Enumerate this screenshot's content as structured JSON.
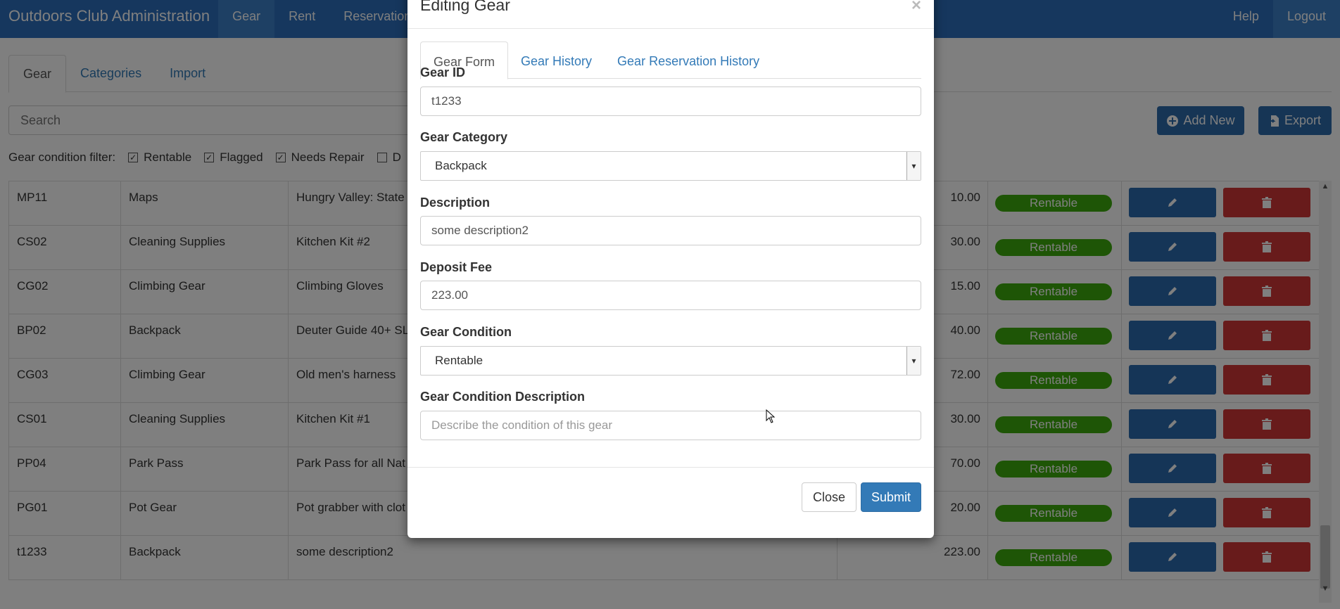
{
  "navbar": {
    "brand": "Outdoors Club Administration",
    "items": [
      {
        "label": "Gear"
      },
      {
        "label": "Rent"
      },
      {
        "label": "Reservations"
      }
    ],
    "right": [
      {
        "label": "Help"
      },
      {
        "label": "Logout"
      }
    ]
  },
  "subtabs": [
    {
      "label": "Gear"
    },
    {
      "label": "Categories"
    },
    {
      "label": "Import"
    }
  ],
  "toolbar": {
    "search_placeholder": "Search",
    "add_new_label": "Add New",
    "export_label": "Export"
  },
  "filter": {
    "label": "Gear condition filter:",
    "options": [
      {
        "label": "Rentable",
        "checked": true
      },
      {
        "label": "Flagged",
        "checked": true
      },
      {
        "label": "Needs Repair",
        "checked": true
      },
      {
        "label": "D",
        "checked": false
      }
    ]
  },
  "table": {
    "rows": [
      {
        "id": "MP11",
        "category": "Maps",
        "description": "Hungry Valley: State",
        "fee": "10.00",
        "condition": "Rentable"
      },
      {
        "id": "CS02",
        "category": "Cleaning Supplies",
        "description": "Kitchen Kit #2",
        "fee": "30.00",
        "condition": "Rentable"
      },
      {
        "id": "CG02",
        "category": "Climbing Gear",
        "description": "Climbing Gloves",
        "fee": "15.00",
        "condition": "Rentable"
      },
      {
        "id": "BP02",
        "category": "Backpack",
        "description": "Deuter Guide 40+ SL",
        "fee": "40.00",
        "condition": "Rentable"
      },
      {
        "id": "CG03",
        "category": "Climbing Gear",
        "description": "Old men's harness",
        "fee": "72.00",
        "condition": "Rentable"
      },
      {
        "id": "CS01",
        "category": "Cleaning Supplies",
        "description": "Kitchen Kit #1",
        "fee": "30.00",
        "condition": "Rentable"
      },
      {
        "id": "PP04",
        "category": "Park Pass",
        "description": "Park Pass for all Nat",
        "fee": "70.00",
        "condition": "Rentable"
      },
      {
        "id": "PG01",
        "category": "Pot Gear",
        "description": "Pot grabber with clot",
        "fee": "20.00",
        "condition": "Rentable"
      },
      {
        "id": "t1233",
        "category": "Backpack",
        "description": "some description2",
        "fee": "223.00",
        "condition": "Rentable"
      }
    ]
  },
  "modal": {
    "title": "Editing Gear",
    "close_x": "×",
    "tabs": [
      {
        "label": "Gear Form"
      },
      {
        "label": "Gear History"
      },
      {
        "label": "Gear Reservation History"
      }
    ],
    "fields": {
      "gear_id_label": "Gear ID",
      "gear_id_value": "t1233",
      "gear_category_label": "Gear Category",
      "gear_category_value": "Backpack",
      "description_label": "Description",
      "description_value": "some description2",
      "deposit_fee_label": "Deposit Fee",
      "deposit_fee_value": "223.00",
      "gear_condition_label": "Gear Condition",
      "gear_condition_value": "Rentable",
      "condition_desc_label": "Gear Condition Description",
      "condition_desc_placeholder": "Describe the condition of this gear"
    },
    "close_label": "Close",
    "submit_label": "Submit"
  },
  "colors": {
    "navbar": "#2c6fbd",
    "badge_green": "#3cab0c",
    "edit_button": "#2a6aae",
    "delete_button": "#d03636",
    "submit_button": "#337ab7"
  }
}
